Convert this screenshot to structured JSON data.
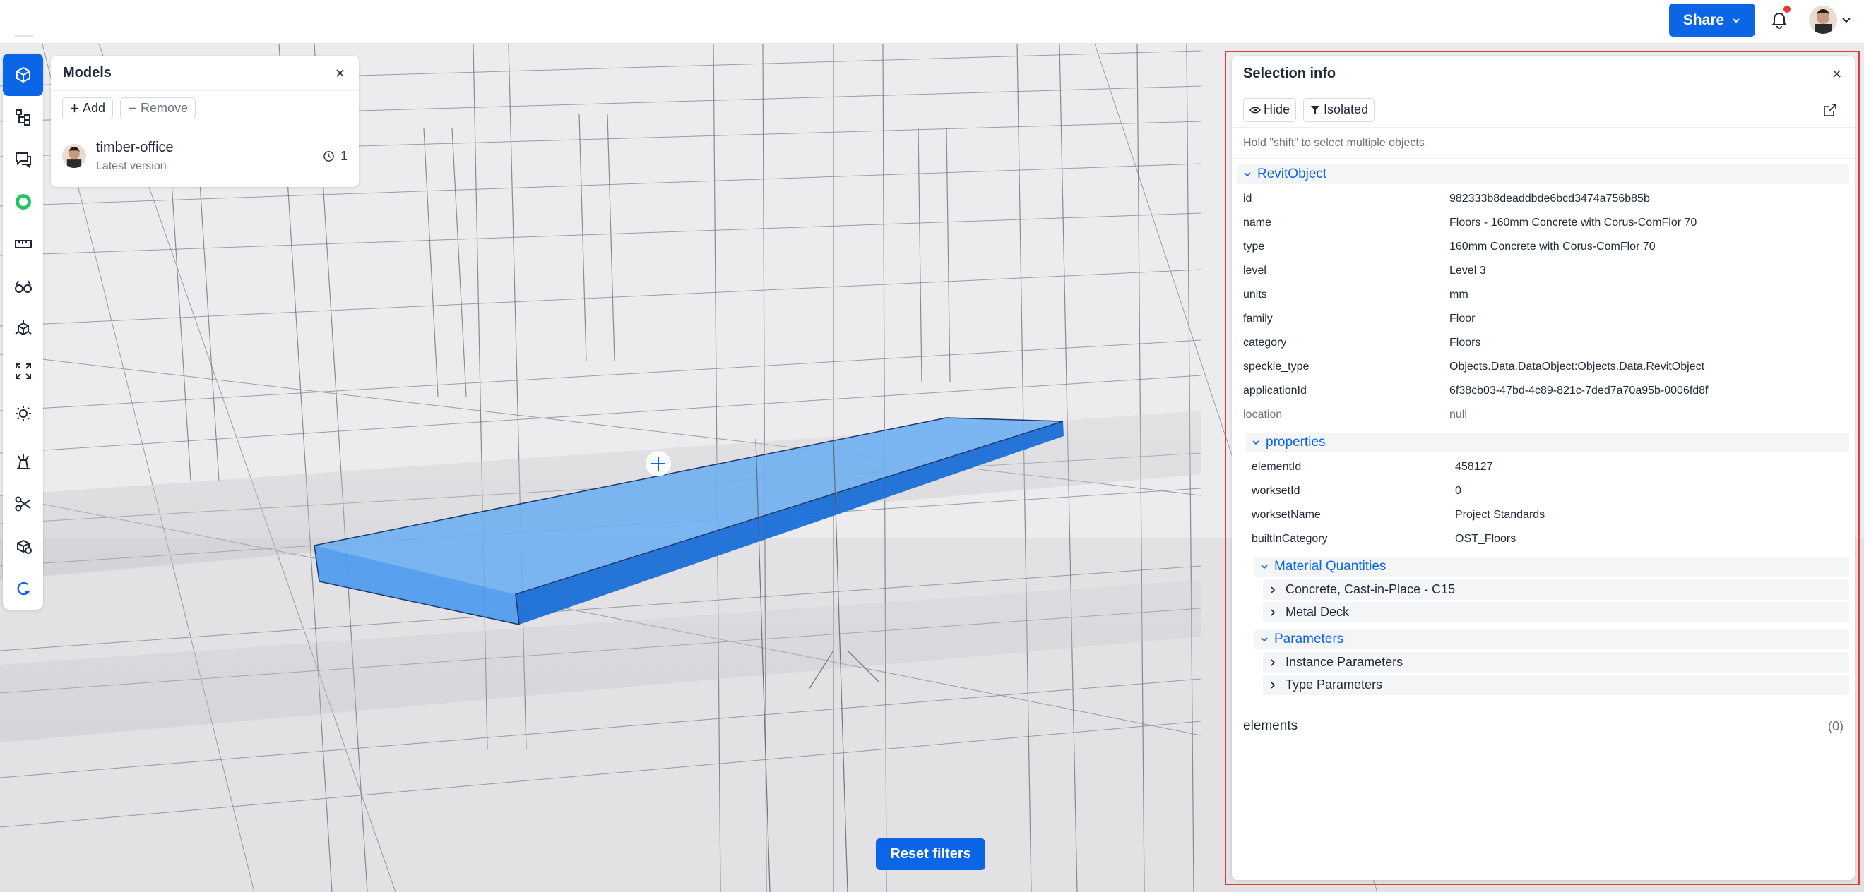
{
  "topbar": {
    "share_label": "Share",
    "icons": [
      "chevron-down-icon",
      "bell-icon",
      "user-avatar"
    ]
  },
  "toolbar": {
    "tools": [
      "models-icon",
      "scene-explorer-icon",
      "discussions-icon",
      "status-icon",
      "measure-icon",
      "views-icon",
      "explode-icon",
      "zoom-extents-icon",
      "light-icon",
      "view-modes-icon",
      "section-icon",
      "filter-icon",
      "speckle-icon"
    ]
  },
  "models_panel": {
    "title": "Models",
    "add_label": "Add",
    "remove_label": "Remove",
    "model": {
      "name": "timber-office",
      "version": "Latest version",
      "count": "1"
    }
  },
  "viewer": {
    "reset_label": "Reset filters",
    "colors": {
      "highlight": "#4a9af0",
      "highlight_dark": "#0a66e6"
    }
  },
  "selection": {
    "title": "Selection info",
    "hide_label": "Hide",
    "isolated_label": "Isolated",
    "hint": "Hold \"shift\" to select multiple objects",
    "root_label": "RevitObject",
    "fields": [
      {
        "key": "id",
        "value": "982333b8deaddbde6bcd3474a756b85b"
      },
      {
        "key": "name",
        "value": "Floors - 160mm Concrete with Corus-ComFlor 70"
      },
      {
        "key": "type",
        "value": "160mm Concrete with Corus-ComFlor 70"
      },
      {
        "key": "level",
        "value": "Level 3"
      },
      {
        "key": "units",
        "value": "mm"
      },
      {
        "key": "family",
        "value": "Floor"
      },
      {
        "key": "category",
        "value": "Floors"
      },
      {
        "key": "speckle_type",
        "value": "Objects.Data.DataObject:Objects.Data.RevitObject"
      },
      {
        "key": "applicationId",
        "value": "6f38cb03-47bd-4c89-821c-7ded7a70a95b-0006fd8f"
      },
      {
        "key": "location",
        "value": "null"
      }
    ],
    "properties_label": "properties",
    "properties": [
      {
        "key": "elementId",
        "value": "458127"
      },
      {
        "key": "worksetId",
        "value": "0"
      },
      {
        "key": "worksetName",
        "value": "Project Standards"
      },
      {
        "key": "builtInCategory",
        "value": "OST_Floors"
      }
    ],
    "material_label": "Material Quantities",
    "materials": [
      "Concrete, Cast-in-Place - C15",
      "Metal Deck"
    ],
    "parameters_label": "Parameters",
    "parameters": [
      "Instance Parameters",
      "Type Parameters"
    ],
    "elements_label": "elements",
    "elements_count": "(0)"
  }
}
